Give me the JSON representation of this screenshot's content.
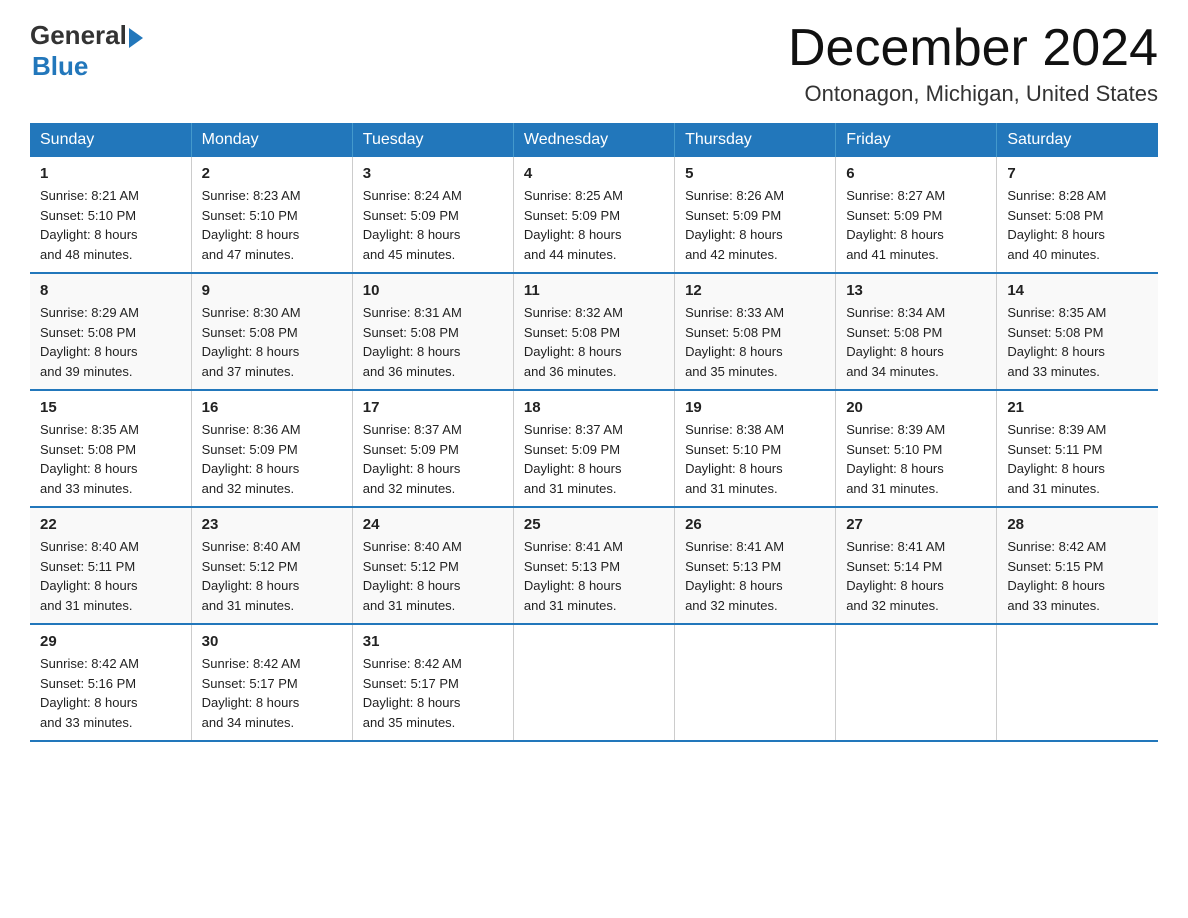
{
  "header": {
    "logo_general": "General",
    "logo_blue": "Blue",
    "month_title": "December 2024",
    "location": "Ontonagon, Michigan, United States"
  },
  "days_of_week": [
    "Sunday",
    "Monday",
    "Tuesday",
    "Wednesday",
    "Thursday",
    "Friday",
    "Saturday"
  ],
  "weeks": [
    [
      {
        "day": "1",
        "sunrise": "8:21 AM",
        "sunset": "5:10 PM",
        "daylight": "8 hours and 48 minutes."
      },
      {
        "day": "2",
        "sunrise": "8:23 AM",
        "sunset": "5:10 PM",
        "daylight": "8 hours and 47 minutes."
      },
      {
        "day": "3",
        "sunrise": "8:24 AM",
        "sunset": "5:09 PM",
        "daylight": "8 hours and 45 minutes."
      },
      {
        "day": "4",
        "sunrise": "8:25 AM",
        "sunset": "5:09 PM",
        "daylight": "8 hours and 44 minutes."
      },
      {
        "day": "5",
        "sunrise": "8:26 AM",
        "sunset": "5:09 PM",
        "daylight": "8 hours and 42 minutes."
      },
      {
        "day": "6",
        "sunrise": "8:27 AM",
        "sunset": "5:09 PM",
        "daylight": "8 hours and 41 minutes."
      },
      {
        "day": "7",
        "sunrise": "8:28 AM",
        "sunset": "5:08 PM",
        "daylight": "8 hours and 40 minutes."
      }
    ],
    [
      {
        "day": "8",
        "sunrise": "8:29 AM",
        "sunset": "5:08 PM",
        "daylight": "8 hours and 39 minutes."
      },
      {
        "day": "9",
        "sunrise": "8:30 AM",
        "sunset": "5:08 PM",
        "daylight": "8 hours and 37 minutes."
      },
      {
        "day": "10",
        "sunrise": "8:31 AM",
        "sunset": "5:08 PM",
        "daylight": "8 hours and 36 minutes."
      },
      {
        "day": "11",
        "sunrise": "8:32 AM",
        "sunset": "5:08 PM",
        "daylight": "8 hours and 36 minutes."
      },
      {
        "day": "12",
        "sunrise": "8:33 AM",
        "sunset": "5:08 PM",
        "daylight": "8 hours and 35 minutes."
      },
      {
        "day": "13",
        "sunrise": "8:34 AM",
        "sunset": "5:08 PM",
        "daylight": "8 hours and 34 minutes."
      },
      {
        "day": "14",
        "sunrise": "8:35 AM",
        "sunset": "5:08 PM",
        "daylight": "8 hours and 33 minutes."
      }
    ],
    [
      {
        "day": "15",
        "sunrise": "8:35 AM",
        "sunset": "5:08 PM",
        "daylight": "8 hours and 33 minutes."
      },
      {
        "day": "16",
        "sunrise": "8:36 AM",
        "sunset": "5:09 PM",
        "daylight": "8 hours and 32 minutes."
      },
      {
        "day": "17",
        "sunrise": "8:37 AM",
        "sunset": "5:09 PM",
        "daylight": "8 hours and 32 minutes."
      },
      {
        "day": "18",
        "sunrise": "8:37 AM",
        "sunset": "5:09 PM",
        "daylight": "8 hours and 31 minutes."
      },
      {
        "day": "19",
        "sunrise": "8:38 AM",
        "sunset": "5:10 PM",
        "daylight": "8 hours and 31 minutes."
      },
      {
        "day": "20",
        "sunrise": "8:39 AM",
        "sunset": "5:10 PM",
        "daylight": "8 hours and 31 minutes."
      },
      {
        "day": "21",
        "sunrise": "8:39 AM",
        "sunset": "5:11 PM",
        "daylight": "8 hours and 31 minutes."
      }
    ],
    [
      {
        "day": "22",
        "sunrise": "8:40 AM",
        "sunset": "5:11 PM",
        "daylight": "8 hours and 31 minutes."
      },
      {
        "day": "23",
        "sunrise": "8:40 AM",
        "sunset": "5:12 PM",
        "daylight": "8 hours and 31 minutes."
      },
      {
        "day": "24",
        "sunrise": "8:40 AM",
        "sunset": "5:12 PM",
        "daylight": "8 hours and 31 minutes."
      },
      {
        "day": "25",
        "sunrise": "8:41 AM",
        "sunset": "5:13 PM",
        "daylight": "8 hours and 31 minutes."
      },
      {
        "day": "26",
        "sunrise": "8:41 AM",
        "sunset": "5:13 PM",
        "daylight": "8 hours and 32 minutes."
      },
      {
        "day": "27",
        "sunrise": "8:41 AM",
        "sunset": "5:14 PM",
        "daylight": "8 hours and 32 minutes."
      },
      {
        "day": "28",
        "sunrise": "8:42 AM",
        "sunset": "5:15 PM",
        "daylight": "8 hours and 33 minutes."
      }
    ],
    [
      {
        "day": "29",
        "sunrise": "8:42 AM",
        "sunset": "5:16 PM",
        "daylight": "8 hours and 33 minutes."
      },
      {
        "day": "30",
        "sunrise": "8:42 AM",
        "sunset": "5:17 PM",
        "daylight": "8 hours and 34 minutes."
      },
      {
        "day": "31",
        "sunrise": "8:42 AM",
        "sunset": "5:17 PM",
        "daylight": "8 hours and 35 minutes."
      },
      null,
      null,
      null,
      null
    ]
  ],
  "labels": {
    "sunrise": "Sunrise:",
    "sunset": "Sunset:",
    "daylight": "Daylight:"
  }
}
